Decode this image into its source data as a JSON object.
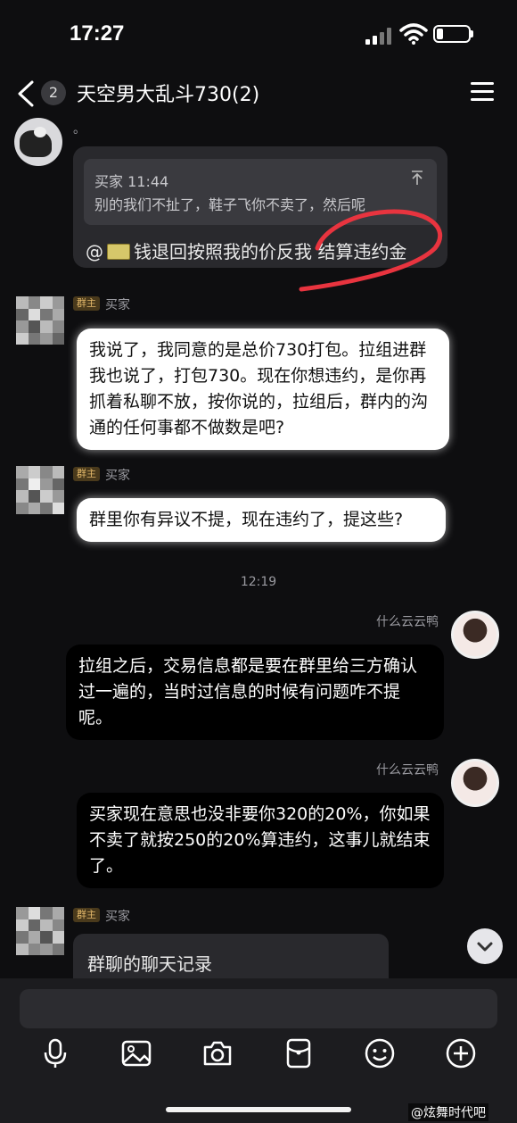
{
  "status": {
    "time": "17:27"
  },
  "header": {
    "badge": "2",
    "title": "天空男大乱斗730(2)"
  },
  "messages": {
    "first_sender_text": "。",
    "quote_sender": "买家 11:44",
    "quote_text": "别的我们不扯了，鞋子飞你不卖了，然后呢",
    "mention_prefix": "@",
    "mention_text": "钱退回按照我的价反我 结算违约金",
    "role_badge": "群主",
    "buyer_name": "买家",
    "msg2": "我说了，我同意的是总价730打包。拉组进群我也说了，打包730。现在你想违约，是你再抓着私聊不放，按你说的，拉组后，群内的沟通的任何事都不做数是吧?",
    "msg3": "群里你有异议不提，现在违约了，提这些?",
    "time_divider": "12:19",
    "right_name": "什么云云鸭",
    "msg4": "拉组之后，交易信息都是要在群里给三方确认过一遍的，当时过信息的时候有问题咋不提呢。",
    "msg5": "买家现在意思也没非要你320的20%，你如果不卖了就按250的20%算违约，这事儿就结束了。",
    "msg6": "群聊的聊天记录"
  },
  "watermark": "@炫舞时代吧",
  "colors": {
    "annotation_circle": "#e8343f",
    "badge_text": "#e3b86a"
  },
  "icons": [
    "microphone-icon",
    "image-icon",
    "camera-icon",
    "red-packet-icon",
    "emoji-icon",
    "plus-icon",
    "chevron-down-icon",
    "back-icon",
    "menu-icon"
  ]
}
